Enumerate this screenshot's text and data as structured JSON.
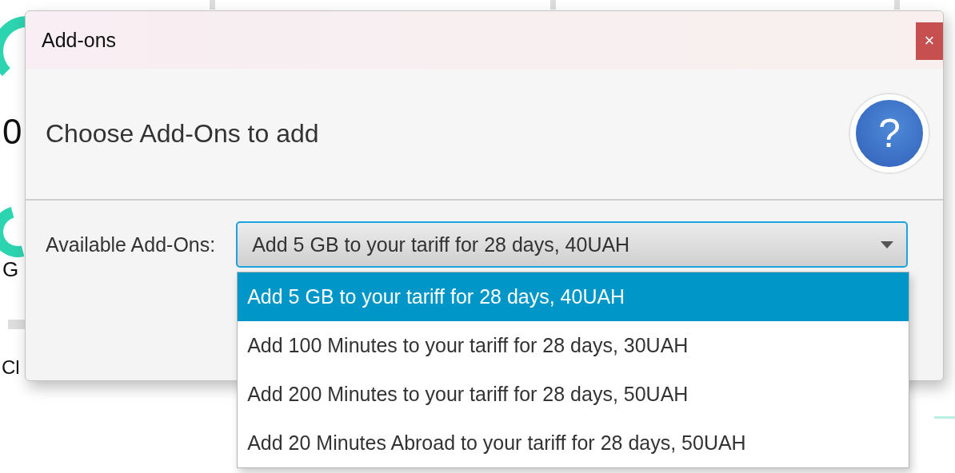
{
  "background": {
    "texts": [
      "0",
      "G",
      "Cl"
    ]
  },
  "dialog": {
    "title": "Add-ons",
    "close": "×",
    "header": "Choose Add-Ons to add",
    "help": "?",
    "field_label": "Available Add-Ons:",
    "combo": {
      "value": "Add 5 GB to your tariff for 28 days, 40UAH",
      "expanded": true,
      "options": [
        {
          "label": "Add 5 GB to your tariff for 28 days, 40UAH",
          "selected": true
        },
        {
          "label": "Add 100 Minutes to your tariff for 28 days, 30UAH",
          "selected": false
        },
        {
          "label": "Add 200 Minutes to your tariff for 28 days, 50UAH",
          "selected": false
        },
        {
          "label": "Add 20 Minutes Abroad to your tariff for 28 days, 50UAH",
          "selected": false
        }
      ]
    }
  }
}
